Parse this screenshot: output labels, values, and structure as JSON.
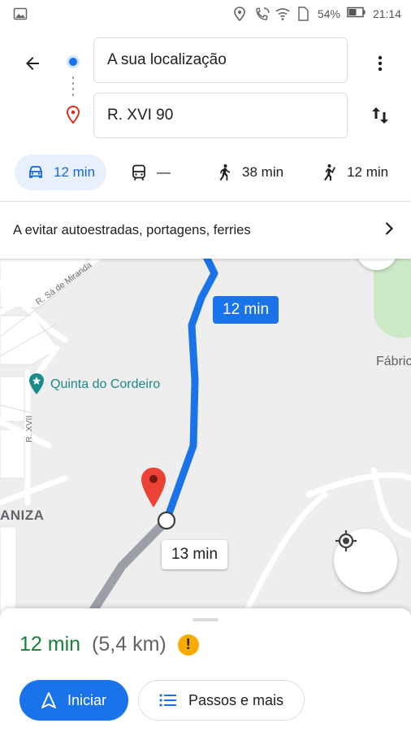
{
  "status_bar": {
    "battery_percent": "54%",
    "time": "21:14",
    "icons": [
      "image-icon",
      "location-icon",
      "call-wifi-icon",
      "wifi-icon",
      "sim-icon",
      "battery-icon"
    ]
  },
  "directions": {
    "origin_value": "A sua localização",
    "destination_value": "R. XVI 90"
  },
  "modes": [
    {
      "icon": "car-icon",
      "label": "12 min",
      "active": true
    },
    {
      "icon": "transit-icon",
      "label": "—",
      "active": false
    },
    {
      "icon": "walk-icon",
      "label": "38 min",
      "active": false
    },
    {
      "icon": "ride-icon",
      "label": "12 min",
      "active": false
    }
  ],
  "avoid": {
    "text": "A evitar autoestradas, portagens, ferries"
  },
  "map": {
    "labels": {
      "fabric": "Fábric",
      "poi": "Quinta do Cordeiro",
      "area": "ANIZA",
      "street_sa": "R. Sá de Miranda",
      "street_xvii": "R. XVII"
    },
    "route_time": "12 min",
    "alt_route_time": "13 min",
    "colors": {
      "route": "#1a73e8",
      "alt_route": "#9aa0a6",
      "pin": "#db4437",
      "park": "#cce9c6"
    }
  },
  "sheet": {
    "duration": "12 min",
    "distance": "(5,4 km)",
    "warning": "!",
    "start_label": "Iniciar",
    "steps_label": "Passos e mais"
  }
}
